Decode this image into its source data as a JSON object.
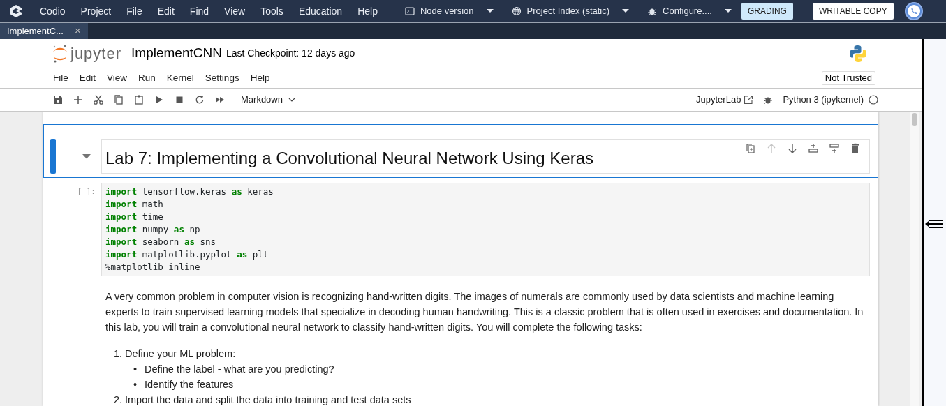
{
  "codio_bar": {
    "menu": [
      "Codio",
      "Project",
      "File",
      "Edit",
      "Find",
      "View",
      "Tools",
      "Education",
      "Help"
    ],
    "dropdowns": [
      {
        "kind": "terminal",
        "label": "Node version"
      },
      {
        "kind": "globe",
        "label": "Project Index (static)"
      },
      {
        "kind": "bug",
        "label": "Configure...."
      }
    ],
    "buttons": [
      {
        "kind": "grading",
        "label": "GRADING"
      },
      {
        "kind": "plain",
        "label": "WRITABLE COPY"
      }
    ]
  },
  "file_tabs": [
    {
      "label": "ImplementC...",
      "close": "×",
      "selected": true
    }
  ],
  "jupyter": {
    "logo_text": "jupyter",
    "notebook_name": "ImplementCNN",
    "checkpoint": "Last Checkpoint: 12 days ago",
    "menu": [
      "File",
      "Edit",
      "View",
      "Run",
      "Kernel",
      "Settings",
      "Help"
    ],
    "trust": "Not Trusted",
    "toolbar": [
      {
        "kind": "save"
      },
      {
        "kind": "add"
      },
      {
        "kind": "cut"
      },
      {
        "kind": "copy"
      },
      {
        "kind": "paste"
      },
      {
        "kind": "run"
      },
      {
        "kind": "stop"
      },
      {
        "kind": "restart"
      },
      {
        "kind": "fast-forward"
      }
    ],
    "cell_type": "Markdown",
    "open_lab": "JupyterLab",
    "kernel": "Python 3 (ipykernel)",
    "kernel_busy": false
  },
  "cells": [
    {
      "kind": "heading",
      "selected": true,
      "expanded": true,
      "text": "Lab 7: Implementing a Convolutional Neural Network Using Keras",
      "toolbar": [
        {
          "kind": "duplicate",
          "disabled": false
        },
        {
          "kind": "up",
          "disabled": true
        },
        {
          "kind": "down",
          "disabled": false
        },
        {
          "kind": "insert-above",
          "disabled": false
        },
        {
          "kind": "insert-below",
          "disabled": false
        },
        {
          "kind": "delete",
          "disabled": false
        }
      ]
    },
    {
      "kind": "code",
      "selected": false,
      "prompt": "[ ]:",
      "lines": [
        [
          {
            "text": "import",
            "kind": "keyword"
          },
          {
            "text": "tensorflow.keras",
            "kind": "name"
          },
          {
            "text": "as",
            "kind": "keyword"
          },
          {
            "text": "keras",
            "kind": "name"
          }
        ],
        [
          {
            "text": "import",
            "kind": "keyword"
          },
          {
            "text": "math",
            "kind": "name"
          }
        ],
        [
          {
            "text": "import",
            "kind": "keyword"
          },
          {
            "text": "time",
            "kind": "name"
          }
        ],
        [
          {
            "text": "import",
            "kind": "keyword"
          },
          {
            "text": "numpy",
            "kind": "name"
          },
          {
            "text": "as",
            "kind": "keyword"
          },
          {
            "text": "np",
            "kind": "name"
          }
        ],
        [
          {
            "text": "import",
            "kind": "keyword"
          },
          {
            "text": "seaborn",
            "kind": "name"
          },
          {
            "text": "as",
            "kind": "keyword"
          },
          {
            "text": "sns",
            "kind": "name"
          }
        ],
        [
          {
            "text": "import",
            "kind": "keyword"
          },
          {
            "text": "matplotlib.pyplot",
            "kind": "name"
          },
          {
            "text": "as",
            "kind": "keyword"
          },
          {
            "text": "plt",
            "kind": "name"
          }
        ],
        [
          {
            "text": "%matplotlib inline",
            "kind": "name"
          }
        ]
      ]
    },
    {
      "kind": "markdown",
      "selected": false,
      "paragraph": "A very common problem in computer vision is recognizing hand-written digits. The images of numerals are commonly used by data scientists and machine learning experts to train supervised learning models that specialize in decoding human handwriting. This is a classic problem that is often used in exercises and documentation. In this lab, you will train a convolutional neural network to classify hand-written digits. You will complete the following tasks:",
      "list": [
        {
          "marker": "1.",
          "text": "Define your ML problem:",
          "children": [
            {
              "marker": "•",
              "text": "Define the label - what are you predicting?"
            },
            {
              "marker": "•",
              "text": "Identify the features"
            }
          ]
        },
        {
          "marker": "2.",
          "text": "Import the data and split the data into training and test data sets"
        }
      ]
    }
  ]
}
